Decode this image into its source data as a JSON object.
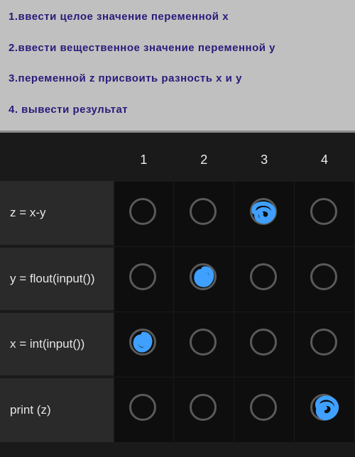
{
  "instructions": {
    "line1": "1.ввести целое значение переменной x",
    "line2": "2.ввести вещественное значение переменной y",
    "line3": "3.переменной z присвоить разность x и y",
    "line4": "4. вывести результат"
  },
  "columns": {
    "c1": "1",
    "c2": "2",
    "c3": "3",
    "c4": "4"
  },
  "rows": {
    "r1": {
      "label": "z = x-y"
    },
    "r2": {
      "label": "y = flout(input())"
    },
    "r3": {
      "label": "x = int(input())"
    },
    "r4": {
      "label": "print (z)"
    }
  },
  "marks": {
    "r1c3": "loop",
    "r2c2": "blob",
    "r3c1": "blob",
    "r4c4": "loop"
  },
  "colors": {
    "mark": "#3fa0ff"
  }
}
